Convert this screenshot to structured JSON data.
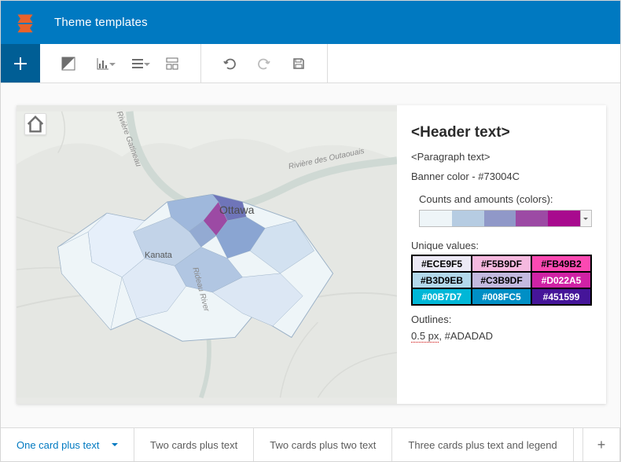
{
  "header": {
    "title": "Theme templates"
  },
  "flyout_glyph": "〉",
  "sidepanel": {
    "header": "<Header text>",
    "paragraph": "<Paragraph text>",
    "banner_color_label": "Banner color - #73004C",
    "ramp_label": "Counts and amounts (colors):",
    "ramp_stops": [
      "#eef5f8",
      "#b6cce2",
      "#9098c8",
      "#9c4aa4",
      "#a80a8e"
    ],
    "unique_label": "Unique values:",
    "unique_values": [
      {
        "label": "#ECE9F5",
        "bg": "#ECE9F5",
        "fg": "#000000"
      },
      {
        "label": "#F5B9DF",
        "bg": "#F5B9DF",
        "fg": "#000000"
      },
      {
        "label": "#FB49B2",
        "bg": "#FB49B2",
        "fg": "#000000"
      },
      {
        "label": "#B3D9EB",
        "bg": "#B3D9EB",
        "fg": "#000000"
      },
      {
        "label": "#C3B9DF",
        "bg": "#C3B9DF",
        "fg": "#000000"
      },
      {
        "label": "#D022A5",
        "bg": "#D022A5",
        "fg": "#ffffff"
      },
      {
        "label": "#00B7D7",
        "bg": "#00B7D7",
        "fg": "#ffffff"
      },
      {
        "label": "#008FC5",
        "bg": "#008FC5",
        "fg": "#ffffff"
      },
      {
        "label": "#451599",
        "bg": "#451599",
        "fg": "#ffffff"
      }
    ],
    "outlines_label": "Outlines:",
    "outlines_value_px": "0.5 px",
    "outlines_value_color": ", #ADADAD"
  },
  "map": {
    "labels": {
      "ottawa": "Ottawa",
      "kanata": "Kanata",
      "gatineau": "Rivière Gatineau",
      "outaouais": "Rivière des Outaouais",
      "rideau": "Rideau River"
    }
  },
  "tabs": [
    {
      "label": "One card plus text",
      "active": true
    },
    {
      "label": "Two cards plus text",
      "active": false
    },
    {
      "label": "Two cards plus two text",
      "active": false
    },
    {
      "label": "Three cards plus text and legend",
      "active": false
    }
  ]
}
